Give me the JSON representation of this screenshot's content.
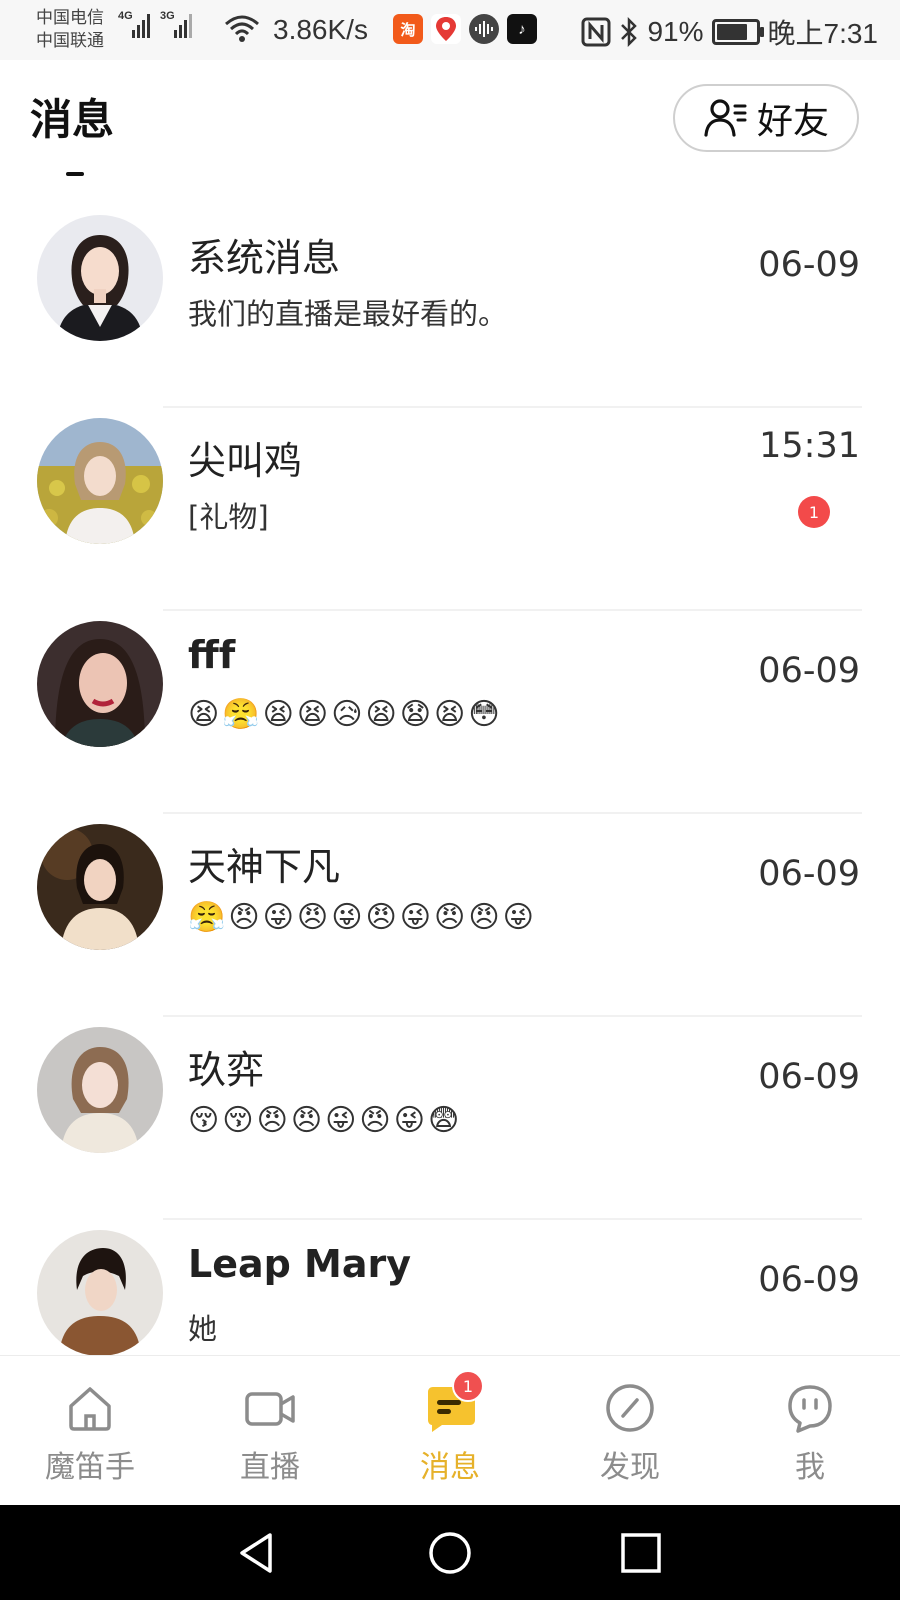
{
  "status_bar": {
    "carrier_1": "中国电信",
    "carrier_2": "中国联通",
    "signal_1": "4G",
    "signal_2": "3G",
    "speed": "3.86K/s",
    "battery": "91%",
    "battery_level": 0.91,
    "time": "晚上7:31",
    "app_icons": [
      "taobao-icon",
      "baidu-map-icon",
      "audio-app-icon",
      "tiktok-icon"
    ],
    "nfc_label": "N"
  },
  "header": {
    "title": "消息",
    "friends_label": "好友"
  },
  "messages": [
    {
      "name": "系统消息",
      "preview": "我们的直播是最好看的。",
      "time": "06-09"
    },
    {
      "name": "尖叫鸡",
      "preview": "[礼物]",
      "time": "15:31",
      "unread": "1"
    },
    {
      "name": "fff",
      "preview_emojis": [
        "😫",
        "😤",
        "😫",
        "😫",
        "😥",
        "😫",
        "😧",
        "😫",
        "😳"
      ],
      "time": "06-09"
    },
    {
      "name": "天神下凡",
      "preview_emojis": [
        "😤",
        "😠",
        "😜",
        "😠",
        "😜",
        "😠",
        "😜",
        "😠",
        "😠",
        "😜"
      ],
      "time": "06-09"
    },
    {
      "name": "玖弈",
      "preview_emojis": [
        "😚",
        "😚",
        "😠",
        "😠",
        "😜",
        "😠",
        "😜",
        "😨"
      ],
      "time": "06-09"
    },
    {
      "name": "Leap Mary",
      "preview": "她",
      "time": "06-09"
    }
  ],
  "bottom_nav": {
    "items": [
      {
        "label": "魔笛手",
        "icon": "home-icon"
      },
      {
        "label": "直播",
        "icon": "video-camera-icon"
      },
      {
        "label": "消息",
        "icon": "message-icon",
        "badge": "1",
        "active": true
      },
      {
        "label": "发现",
        "icon": "compass-icon"
      },
      {
        "label": "我",
        "icon": "profile-face-icon"
      }
    ],
    "active_color": "#e6b12a",
    "inactive_color": "#8c8c8c"
  },
  "system_nav": {
    "buttons": [
      "back-icon",
      "home-circle-icon",
      "recents-square-icon"
    ]
  }
}
